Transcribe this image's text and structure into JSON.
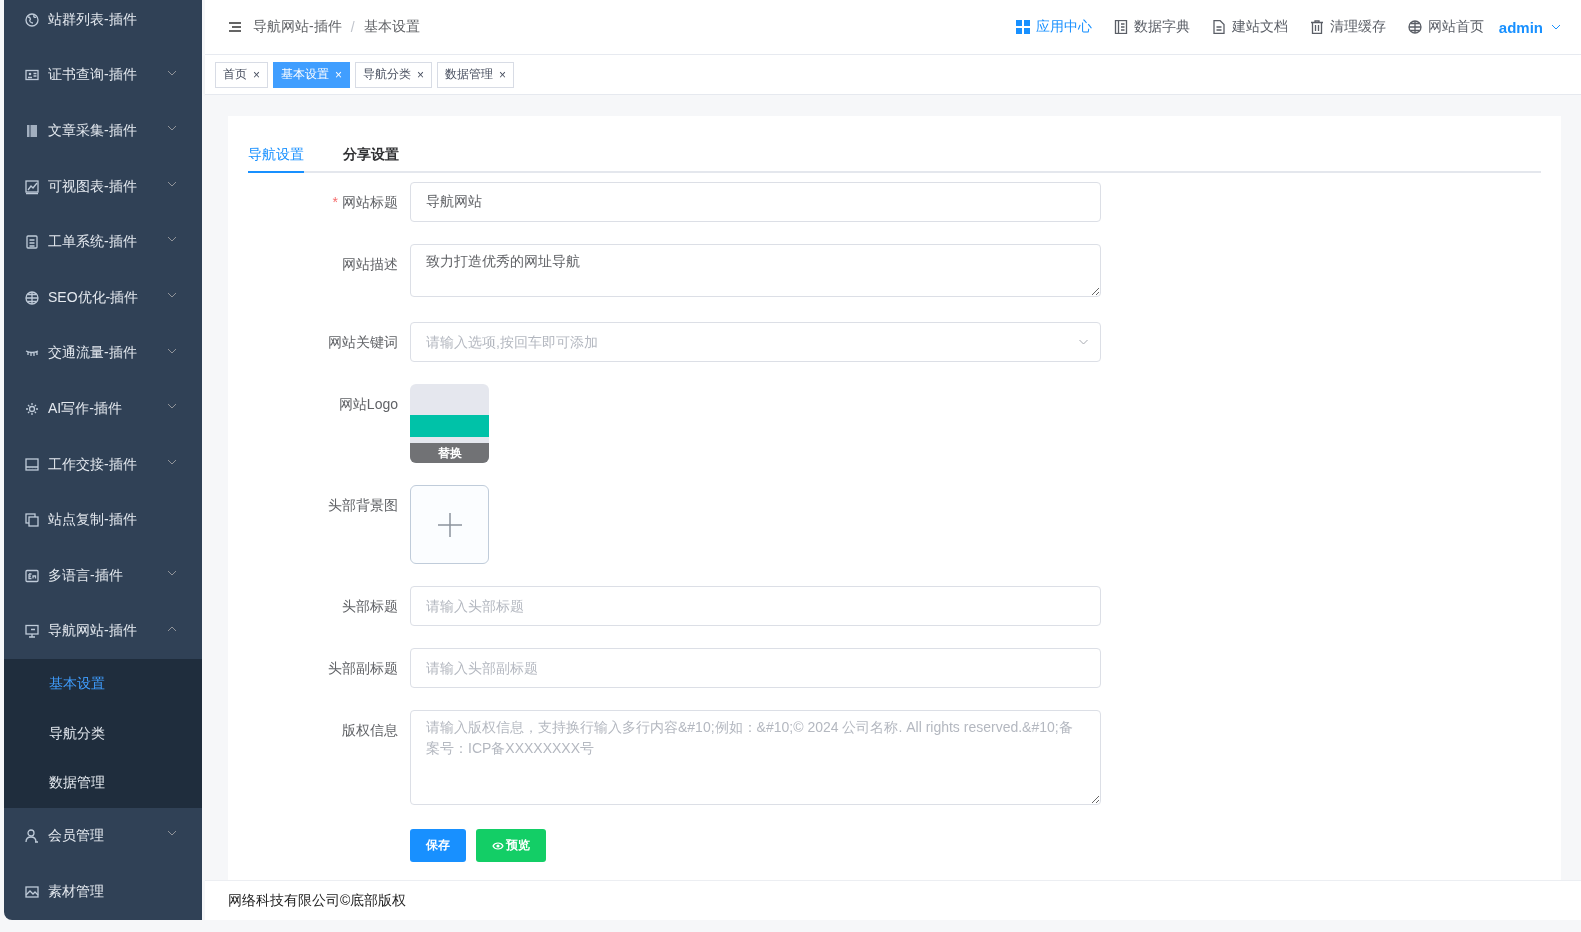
{
  "sidebar": {
    "items": [
      {
        "label": "站群列表-插件",
        "kind": "link"
      },
      {
        "label": "证书查询-插件",
        "kind": "submenu",
        "expanded": false
      },
      {
        "label": "文章采集-插件",
        "kind": "submenu",
        "expanded": false
      },
      {
        "label": "可视图表-插件",
        "kind": "submenu",
        "expanded": false
      },
      {
        "label": "工单系统-插件",
        "kind": "submenu",
        "expanded": false
      },
      {
        "label": "SEO优化-插件",
        "kind": "submenu",
        "expanded": false
      },
      {
        "label": "交通流量-插件",
        "kind": "submenu",
        "expanded": false
      },
      {
        "label": "AI写作-插件",
        "kind": "submenu",
        "expanded": false
      },
      {
        "label": "工作交接-插件",
        "kind": "submenu",
        "expanded": false
      },
      {
        "label": "站点复制-插件",
        "kind": "link"
      },
      {
        "label": "多语言-插件",
        "kind": "submenu",
        "expanded": false
      },
      {
        "label": "导航网站-插件",
        "kind": "submenu",
        "expanded": true,
        "children": [
          {
            "label": "基本设置",
            "selected": true
          },
          {
            "label": "导航分类",
            "selected": false
          },
          {
            "label": "数据管理",
            "selected": false
          }
        ]
      },
      {
        "label": "会员管理",
        "kind": "submenu",
        "expanded": false
      },
      {
        "label": "素材管理",
        "kind": "link"
      }
    ]
  },
  "header": {
    "breadcrumb": [
      "导航网站-插件",
      "基本设置"
    ],
    "separator": "/",
    "links": [
      {
        "label": "应用中心",
        "selected": true
      },
      {
        "label": "数据字典",
        "selected": false
      },
      {
        "label": "建站文档",
        "selected": false
      },
      {
        "label": "清理缓存",
        "selected": false
      },
      {
        "label": "网站首页",
        "selected": false
      }
    ],
    "user": "admin"
  },
  "tags": [
    {
      "label": "首页",
      "close": "×",
      "selected": false
    },
    {
      "label": "基本设置",
      "close": "×",
      "selected": true
    },
    {
      "label": "导航分类",
      "close": "×",
      "selected": false
    },
    {
      "label": "数据管理",
      "close": "×",
      "selected": false
    }
  ],
  "tabs": [
    {
      "label": "导航设置",
      "selected": true
    },
    {
      "label": "分享设置",
      "selected": false
    }
  ],
  "form": {
    "fields": [
      {
        "kind": "input",
        "label": "网站标题",
        "required_mark": "*",
        "value": "导航网站"
      },
      {
        "kind": "textarea",
        "label": "网站描述",
        "value": "致力打造优秀的网址导航"
      },
      {
        "kind": "select",
        "label": "网站关键词",
        "placeholder": "请输入选项,按回车即可添加"
      },
      {
        "kind": "image",
        "label": "网站Logo",
        "action": "替换"
      },
      {
        "kind": "upload",
        "label": "头部背景图"
      },
      {
        "kind": "input",
        "label": "头部标题",
        "placeholder": "请输入头部标题"
      },
      {
        "kind": "input",
        "label": "头部副标题",
        "placeholder": "请输入头部副标题"
      },
      {
        "kind": "textarea",
        "label": "版权信息",
        "placeholder": "请输入版权信息，支持换行输入多行内容&#10;例如：&#10;© 2024 公司名称. All rights reserved.&#10;备案号：ICP备XXXXXXXX号"
      }
    ],
    "buttons": [
      {
        "label": "保存",
        "kind": "primary"
      },
      {
        "label": "预览",
        "kind": "success"
      }
    ]
  },
  "footer": "网络科技有限公司©底部版权"
}
